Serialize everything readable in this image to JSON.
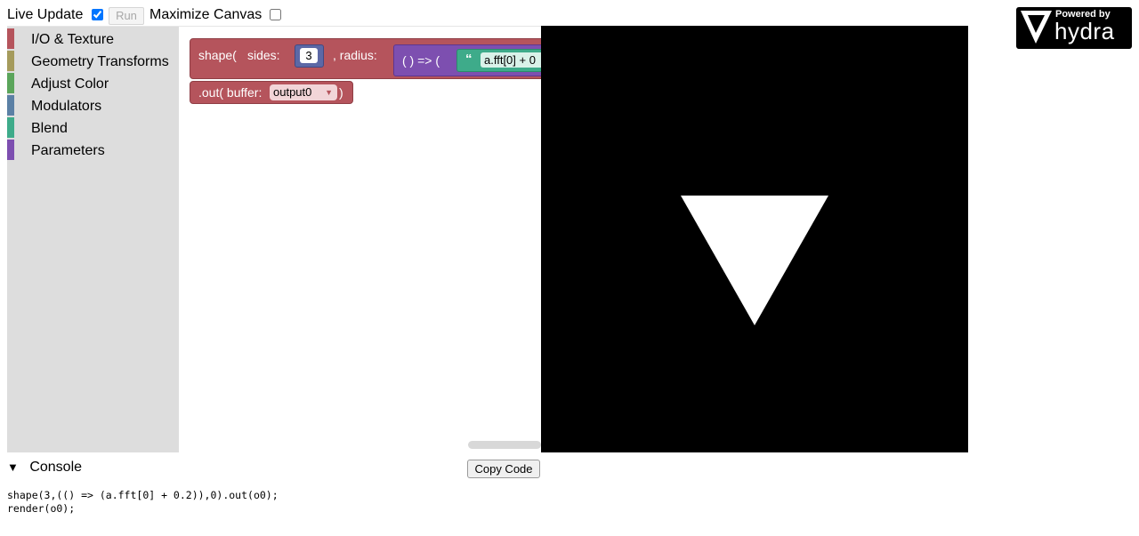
{
  "topbar": {
    "live_update_label": "Live Update",
    "live_update_checked": true,
    "run_label": "Run",
    "maximize_label": "Maximize Canvas",
    "maximize_checked": false
  },
  "toolbox": {
    "categories": [
      {
        "label": "I/O & Texture",
        "color": "#b5545c"
      },
      {
        "label": "Geometry Transforms",
        "color": "#a59b5c"
      },
      {
        "label": "Adjust Color",
        "color": "#5ba55b"
      },
      {
        "label": "Modulators",
        "color": "#5b80a5"
      },
      {
        "label": "Blend",
        "color": "#3eab8a"
      },
      {
        "label": "Parameters",
        "color": "#7d4fb0"
      }
    ]
  },
  "blocks": {
    "shape_label": "shape(",
    "sides_label": "sides:",
    "sides_value": "3",
    "radius_label": ", radius:",
    "arrow_label": "( ) => (",
    "quote_glyph": "“",
    "expr_value": "a.fft[0] + 0",
    "out_label": ".out( buffer:",
    "buffer_value": "output0",
    "out_close": ")"
  },
  "logo": {
    "powered_by": "Powered by",
    "name": "hydra"
  },
  "console": {
    "toggle_glyph": "▼",
    "title": "Console",
    "copy_label": "Copy Code",
    "code": "shape(3,(() => (a.fft[0] + 0.2)),0).out(o0);\nrender(o0);"
  }
}
